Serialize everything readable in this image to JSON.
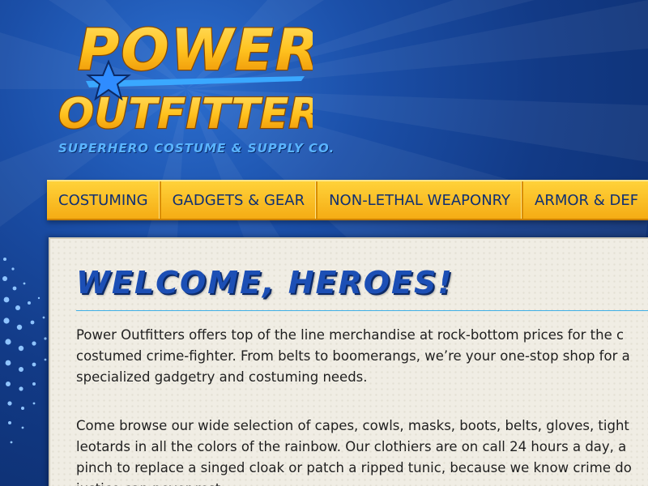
{
  "brand": {
    "logo_line1": "POWER",
    "logo_line2": "OUTFITTERS",
    "tagline": "SUPERHERO COSTUME & SUPPLY CO.",
    "accent_yellow": "#f5b31a",
    "accent_blue": "#1c4fb5",
    "background_blue": "#123a86"
  },
  "nav": {
    "items": [
      {
        "label": "COSTUMING"
      },
      {
        "label": "GADGETS & GEAR"
      },
      {
        "label": "NON-LETHAL WEAPONRY"
      },
      {
        "label": "ARMOR & DEF"
      }
    ]
  },
  "main": {
    "title": "WELCOME, HEROES!",
    "paragraph1_lines": [
      "Power Outfitters offers top of the line merchandise at rock-bottom prices for the c",
      "costumed crime-fighter. From belts to boomerangs, we’re your one-stop shop for a",
      "specialized gadgetry and costuming needs."
    ],
    "paragraph2_lines": [
      "Come browse our wide selection of capes, cowls, masks, boots, belts, gloves, tight",
      "leotards in all the colors of the rainbow. Our clothiers are on call 24 hours a day, a",
      "pinch to replace a singed cloak or patch a ripped tunic, because we know crime do",
      "justice can never rest."
    ]
  },
  "icons": {
    "logo_star": "star-icon"
  }
}
